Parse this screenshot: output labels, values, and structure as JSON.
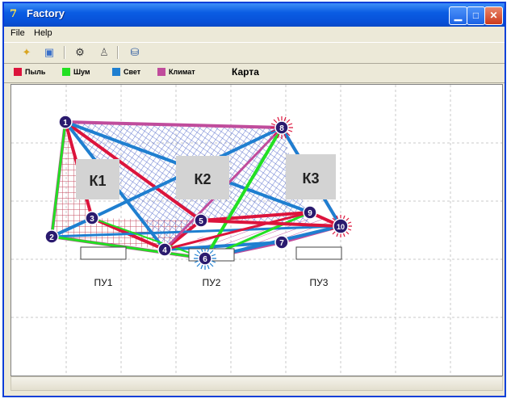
{
  "window": {
    "title": "Factory",
    "icon": "app-icon"
  },
  "menu": {
    "file": "File",
    "help": "Help"
  },
  "toolbar": {
    "icons": [
      "new-icon",
      "open-icon",
      "settings-icon",
      "person-icon",
      "export-icon"
    ]
  },
  "legend": [
    {
      "label": "Пыль",
      "color": "#dc143c"
    },
    {
      "label": "Шум",
      "color": "#22e022"
    },
    {
      "label": "Свет",
      "color": "#1f7fd0"
    },
    {
      "label": "Климат",
      "color": "#c04c9c"
    }
  ],
  "map_title": "Карта",
  "zones": [
    "К1",
    "К2",
    "К3"
  ],
  "panels": [
    "ПУ1",
    "ПУ2",
    "ПУ3"
  ],
  "nodes": [
    "1",
    "2",
    "3",
    "4",
    "5",
    "6",
    "7",
    "8",
    "9",
    "10"
  ],
  "connection_colors": {
    "dust": "#dc143c",
    "noise": "#22e022",
    "light": "#1f7fd0",
    "climate": "#c04c9c",
    "mesh_red": "#c0394f",
    "mesh_blue": "#4b63c8"
  }
}
